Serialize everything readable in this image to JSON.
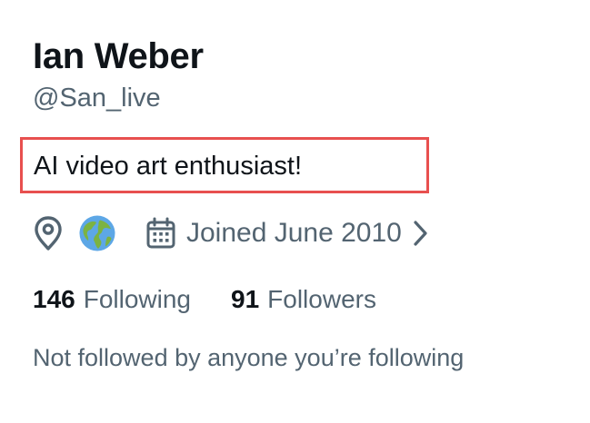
{
  "profile": {
    "display_name": "Ian Weber",
    "handle": "@San_live",
    "bio": "AI video art enthusiast!",
    "joined": "Joined June 2010",
    "following": {
      "count": "146",
      "label": "Following"
    },
    "followers": {
      "count": "91",
      "label": "Followers"
    },
    "followed_by": "Not followed by anyone you’re following"
  },
  "icons": {
    "location": "location-pin-icon",
    "globe": "globe-emoji-icon",
    "calendar": "calendar-icon",
    "chevron": "chevron-right-icon"
  },
  "colors": {
    "primary_text": "#0f1419",
    "secondary_text": "#536471",
    "highlight_border": "#e8504f",
    "background": "#ffffff"
  }
}
